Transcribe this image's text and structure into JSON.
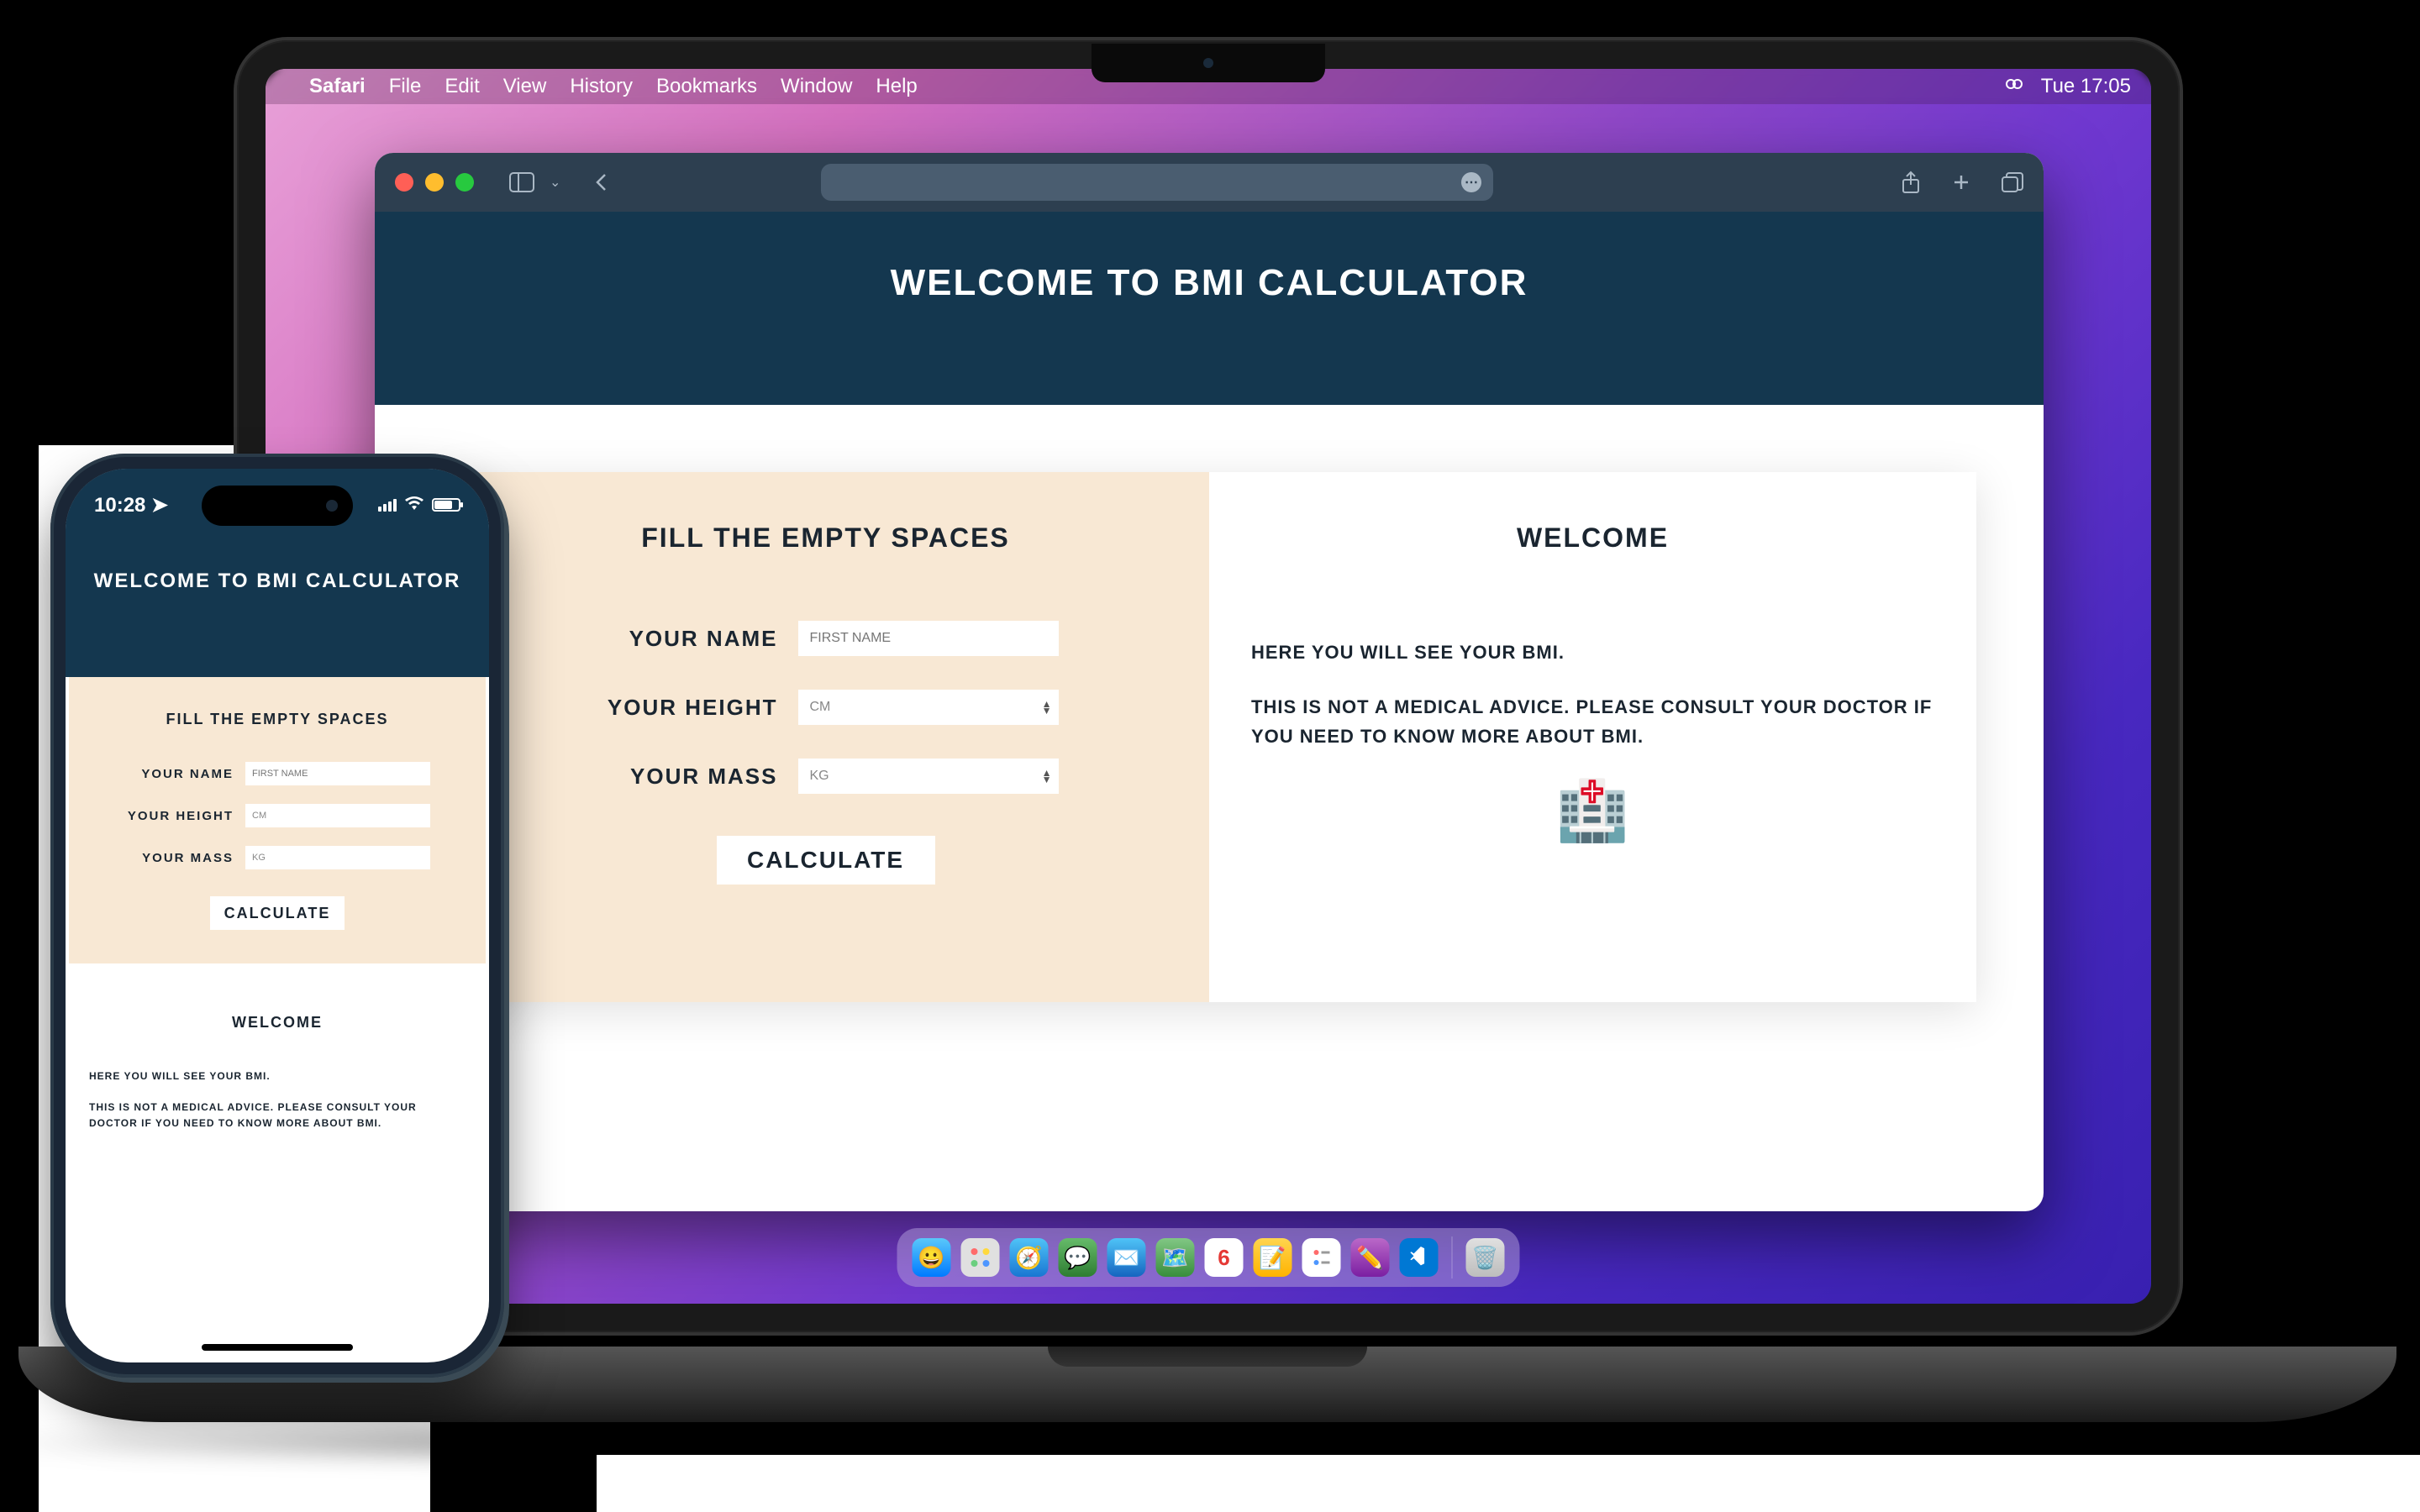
{
  "menubar": {
    "app_name": "Safari",
    "items": [
      "File",
      "Edit",
      "View",
      "History",
      "Bookmarks",
      "Window",
      "Help"
    ],
    "clock": "Tue 17:05"
  },
  "safari": {
    "address": ""
  },
  "desktop": {
    "header_title": "WELCOME TO BMI CALCULATOR",
    "form_title": "FILL THE EMPTY SPACES",
    "label_name": "YOUR NAME",
    "label_height": "YOUR HEIGHT",
    "label_mass": "YOUR MASS",
    "placeholder_name": "FIRST NAME",
    "placeholder_height": "CM",
    "placeholder_mass": "KG",
    "button_calc": "CALCULATE",
    "result_title": "WELCOME",
    "result_line1": "HERE YOU WILL SEE YOUR BMI.",
    "result_line2": "THIS IS NOT A MEDICAL ADVICE. PLEASE CONSULT YOUR DOCTOR IF YOU NEED TO KNOW MORE ABOUT BMI.",
    "hospital_emoji": "🏥"
  },
  "mobile": {
    "status_time": "10:28",
    "header_title": "WELCOME TO BMI CALCULATOR",
    "form_title": "FILL THE EMPTY SPACES",
    "label_name": "YOUR NAME",
    "label_height": "YOUR HEIGHT",
    "label_mass": "YOUR MASS",
    "placeholder_name": "FIRST NAME",
    "placeholder_height": "CM",
    "placeholder_mass": "KG",
    "button_calc": "CALCULATE",
    "result_title": "WELCOME",
    "result_line1": "HERE YOU WILL SEE YOUR BMI.",
    "result_line2": "THIS IS NOT A MEDICAL ADVICE. PLEASE CONSULT YOUR DOCTOR IF YOU NEED TO KNOW MORE ABOUT BMI."
  },
  "dock": {
    "items": [
      "finder",
      "launchpad",
      "safari",
      "messages",
      "mail",
      "maps",
      "calendar",
      "notes",
      "reminders",
      "freeform",
      "vscode"
    ],
    "trash": "trash"
  }
}
